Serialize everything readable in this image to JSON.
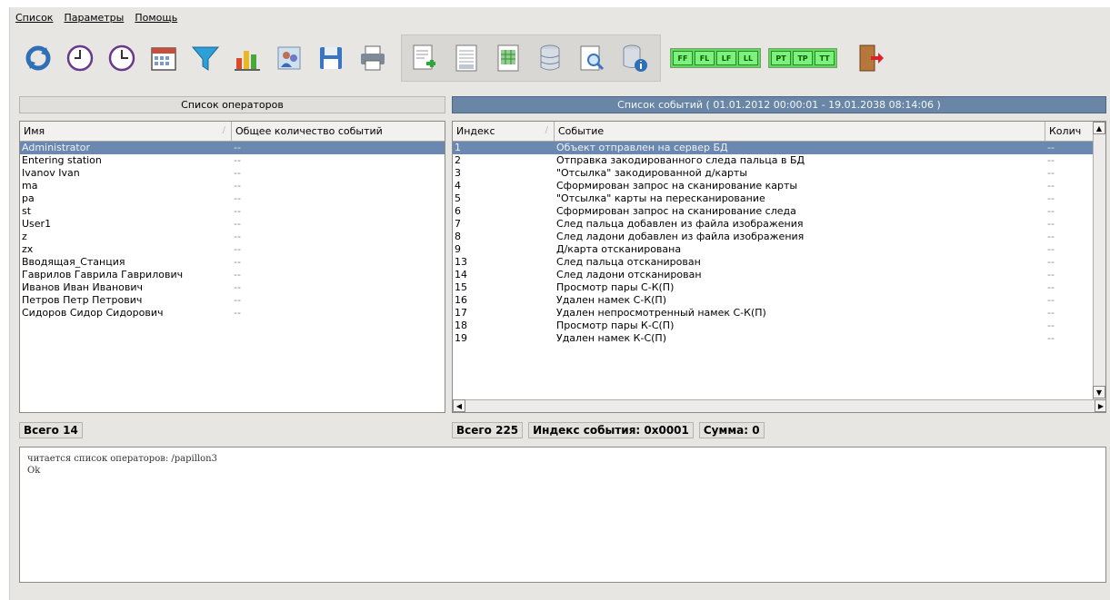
{
  "menu": [
    "Список",
    "Параметры",
    "Помощь"
  ],
  "toolbar": {
    "icons": [
      "refresh-icon",
      "clock-start-icon",
      "clock-end-icon",
      "calendar-icon",
      "filter-icon",
      "chart-icon",
      "people-icon",
      "save-icon",
      "print-icon",
      "export-icon",
      "report-icon",
      "report-green-icon",
      "database-icon",
      "search-doc-icon",
      "db-info-icon"
    ],
    "badge_groups": [
      [
        "FF",
        "FL",
        "LF",
        "LL"
      ],
      [
        "PT",
        "TP",
        "TT"
      ]
    ],
    "exit_icon": "exit-door-icon"
  },
  "operators_panel": {
    "title": "Список операторов",
    "columns": [
      "Имя",
      "Общее количество событий"
    ],
    "rows": [
      [
        "Administrator",
        "--"
      ],
      [
        "Entering station",
        "--"
      ],
      [
        "Ivanov Ivan",
        "--"
      ],
      [
        "ma",
        "--"
      ],
      [
        "pa",
        "--"
      ],
      [
        "st",
        "--"
      ],
      [
        "User1",
        "--"
      ],
      [
        "z",
        "--"
      ],
      [
        "zx",
        "--"
      ],
      [
        "Вводящая_Станция",
        "--"
      ],
      [
        "Гаврилов Гаврила Гаврилович",
        "--"
      ],
      [
        "Иванов Иван Иванович",
        "--"
      ],
      [
        "Петров Петр Петрович",
        "--"
      ],
      [
        "Сидоров Сидор Сидорович",
        "--"
      ]
    ],
    "selected_index": 0,
    "total_label": "Всего 14"
  },
  "events_panel": {
    "title": "Список событий ( 01.01.2012 00:00:01 - 19.01.2038 08:14:06 )",
    "columns": [
      "Индекс",
      "Событие",
      "Колич"
    ],
    "rows": [
      [
        "1",
        "Объект отправлен на сервер БД",
        "--"
      ],
      [
        "2",
        "Отправка закодированного следа пальца в БД",
        "--"
      ],
      [
        "3",
        "\"Отсылка\" закодированной д/карты",
        "--"
      ],
      [
        "4",
        "Сформирован запрос на сканирование карты",
        "--"
      ],
      [
        "5",
        "\"Отсылка\" карты на пересканирование",
        "--"
      ],
      [
        "6",
        "Сформирован запрос на сканирование следа",
        "--"
      ],
      [
        "7",
        "След пальца добавлен из файла изображения",
        "--"
      ],
      [
        "8",
        "След ладони добавлен из файла изображения",
        "--"
      ],
      [
        "9",
        "Д/карта отсканирована",
        "--"
      ],
      [
        "13",
        "След пальца отсканирован",
        "--"
      ],
      [
        "14",
        "След ладони отсканирован",
        "--"
      ],
      [
        "15",
        "Просмотр пары С-К(П)",
        "--"
      ],
      [
        "16",
        "Удален намек С-К(П)",
        "--"
      ],
      [
        "17",
        "Удален непросмотренный намек С-К(П)",
        "--"
      ],
      [
        "18",
        "Просмотр пары К-С(П)",
        "--"
      ],
      [
        "19",
        "Удален намек К-С(П)",
        "--"
      ]
    ],
    "selected_index": 0,
    "total_label": "Всего 225",
    "event_index_label": "Индекс события: 0x0001",
    "sum_label": "Сумма: 0"
  },
  "log": {
    "lines": [
      "читается список операторов: /papillon3",
      "Ok"
    ]
  }
}
